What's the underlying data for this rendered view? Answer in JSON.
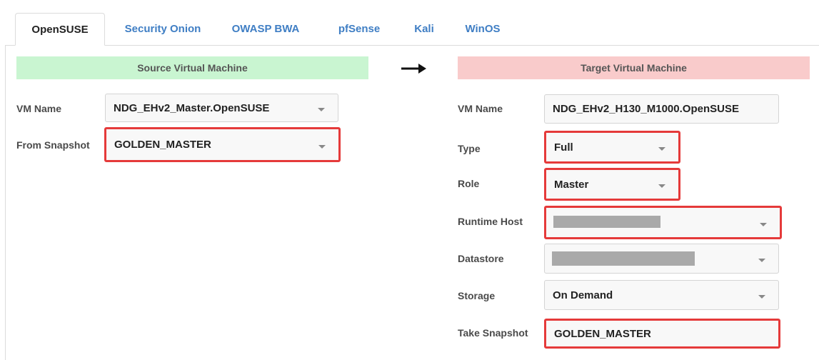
{
  "tabs": [
    {
      "label": "OpenSUSE",
      "active": true
    },
    {
      "label": "Security Onion",
      "active": false
    },
    {
      "label": "OWASP BWA",
      "active": false
    },
    {
      "label": "pfSense",
      "active": false
    },
    {
      "label": "Kali",
      "active": false
    },
    {
      "label": "WinOS",
      "active": false
    }
  ],
  "source": {
    "header": "Source Virtual Machine",
    "vm_name_label": "VM Name",
    "vm_name_value": "NDG_EHv2_Master.OpenSUSE",
    "snapshot_label": "From Snapshot",
    "snapshot_value": "GOLDEN_MASTER"
  },
  "target": {
    "header": "Target Virtual Machine",
    "vm_name_label": "VM Name",
    "vm_name_value": "NDG_EHv2_H130_M1000.OpenSUSE",
    "type_label": "Type",
    "type_value": "Full",
    "role_label": "Role",
    "role_value": "Master",
    "runtime_host_label": "Runtime Host",
    "datastore_label": "Datastore",
    "storage_label": "Storage",
    "storage_value": "On Demand",
    "take_snapshot_label": "Take Snapshot",
    "take_snapshot_value": "GOLDEN_MASTER"
  },
  "colors": {
    "source_header_bg": "#c9f5d1",
    "target_header_bg": "#f9cbcb",
    "highlight_border": "#e53a3a",
    "tab_link": "#3f7ec4"
  },
  "icons": {
    "arrow": "right-arrow-icon",
    "dropdown": "caret-down-icon"
  }
}
